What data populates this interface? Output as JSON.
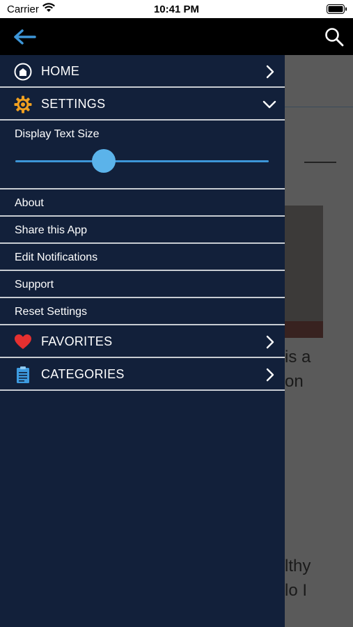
{
  "status_bar": {
    "carrier": "Carrier",
    "time": "10:41 PM"
  },
  "topbar": {
    "back_icon": "back-arrow-icon",
    "search_icon": "search-icon",
    "accent_color": "#3d96d8"
  },
  "drawer": {
    "home": {
      "label": "HOME",
      "icon": "home-icon"
    },
    "settings": {
      "label": "SETTINGS",
      "icon": "gear-icon",
      "expanded": true,
      "text_size": {
        "label": "Display Text Size",
        "value_fraction": 0.35
      },
      "items": [
        {
          "label": "About"
        },
        {
          "label": "Share this App"
        },
        {
          "label": "Edit Notifications"
        },
        {
          "label": "Support"
        },
        {
          "label": "Reset Settings"
        }
      ]
    },
    "favorites": {
      "label": "FAVORITES",
      "icon": "heart-icon"
    },
    "categories": {
      "label": "CATEGORIES",
      "icon": "clipboard-icon"
    }
  },
  "background": {
    "text_lines": [
      "is a",
      "on",
      "lthy",
      "lo I"
    ]
  }
}
